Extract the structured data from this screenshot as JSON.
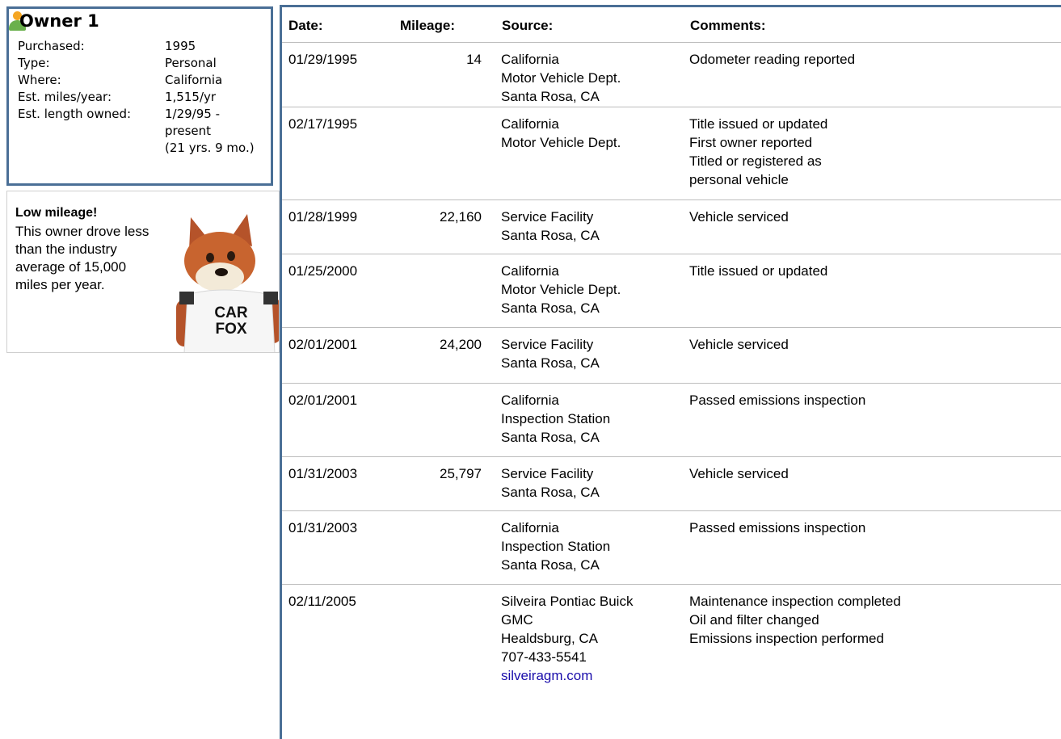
{
  "owner": {
    "title": "Owner 1",
    "fields": [
      {
        "label": "Purchased:",
        "value": "1995"
      },
      {
        "label": "Type:",
        "value": "Personal"
      },
      {
        "label": "Where:",
        "value": "California"
      },
      {
        "label": "Est. miles/year:",
        "value": "1,515/yr"
      },
      {
        "label": "Est. length owned:",
        "value": "1/29/95 -"
      },
      {
        "label": "",
        "value": "present"
      },
      {
        "label": "",
        "value": "(21 yrs. 9 mo.)"
      }
    ]
  },
  "callout": {
    "title": "Low mileage!",
    "text": "This owner drove less than the industry average of 15,000 miles per year.",
    "fox_shirt_line1": "CAR",
    "fox_shirt_line2": "FOX"
  },
  "table": {
    "headers": {
      "date": "Date:",
      "mileage": "Mileage:",
      "source": "Source:",
      "comments": "Comments:"
    },
    "rows": [
      {
        "date": "01/29/1995",
        "mileage": "14",
        "source": [
          "California",
          "Motor Vehicle Dept.",
          "Santa Rosa, CA"
        ],
        "comments": [
          "Odometer reading reported"
        ]
      },
      {
        "date": "02/17/1995",
        "mileage": "",
        "source": [
          "California",
          "Motor Vehicle Dept."
        ],
        "comments": [
          "Title issued or updated",
          "First owner reported",
          "Titled or registered as",
          "personal vehicle"
        ]
      },
      {
        "date": "01/28/1999",
        "mileage": "22,160",
        "source": [
          "Service Facility",
          "Santa Rosa, CA"
        ],
        "comments": [
          "Vehicle serviced"
        ]
      },
      {
        "date": "01/25/2000",
        "mileage": "",
        "source": [
          "California",
          "Motor Vehicle Dept.",
          "Santa Rosa, CA"
        ],
        "comments": [
          "Title issued or updated"
        ]
      },
      {
        "date": "02/01/2001",
        "mileage": "24,200",
        "source": [
          "Service Facility",
          "Santa Rosa, CA"
        ],
        "comments": [
          "Vehicle serviced"
        ]
      },
      {
        "date": "02/01/2001",
        "mileage": "",
        "source": [
          "California",
          "Inspection Station",
          "Santa Rosa, CA"
        ],
        "comments": [
          "Passed emissions inspection"
        ]
      },
      {
        "date": "01/31/2003",
        "mileage": "25,797",
        "source": [
          "Service Facility",
          "Santa Rosa, CA"
        ],
        "comments": [
          "Vehicle serviced"
        ]
      },
      {
        "date": "01/31/2003",
        "mileage": "",
        "source": [
          "California",
          "Inspection Station",
          "Santa Rosa, CA"
        ],
        "comments": [
          "Passed emissions inspection"
        ]
      },
      {
        "date": "02/11/2005",
        "mileage": "",
        "source": [
          "Silveira Pontiac Buick",
          "GMC",
          "Healdsburg, CA",
          "707-433-5541"
        ],
        "source_link": "silveiragm.com",
        "comments": [
          "Maintenance inspection completed",
          "Oil and filter changed",
          "Emissions inspection performed"
        ]
      }
    ]
  },
  "colors": {
    "accent_border": "#4a6f96",
    "link": "#1a0dab",
    "person_icon_head": "#f5a623",
    "person_icon_body": "#6ab04c"
  }
}
